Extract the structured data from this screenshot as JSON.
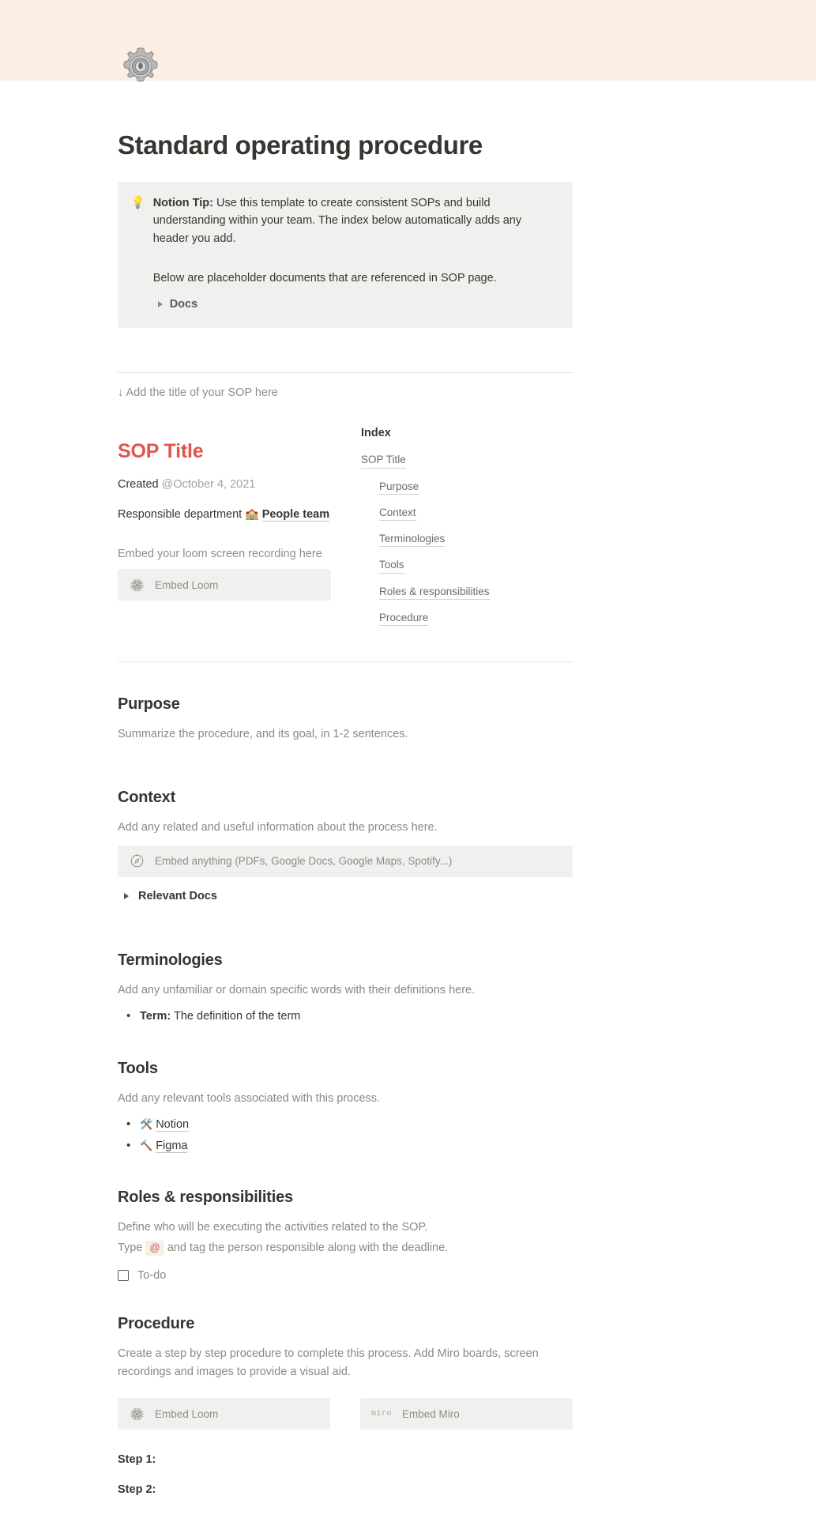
{
  "cover": {
    "color": "#fbeee4"
  },
  "page": {
    "icon": "gear-emoji",
    "title": "Standard operating procedure"
  },
  "callout": {
    "emoji": "light-bulb",
    "tip_label": "Notion Tip:",
    "tip_text": " Use this template to create consistent SOPs and build understanding within your team. The index below automatically adds any header you add.",
    "second_paragraph": "Below are placeholder documents that are referenced in SOP page.",
    "toggle_label": "Docs"
  },
  "hint": "↓ Add the title of your SOP here",
  "sop": {
    "title": "SOP Title",
    "created_label": "Created",
    "created_value": "@October 4, 2021",
    "department_label": "Responsible department",
    "department_emoji": "🏫",
    "department_value": "People team",
    "embed_caption": "Embed your loom screen recording here",
    "embed_loom_label": "Embed Loom"
  },
  "index": {
    "heading": "Index",
    "items": [
      {
        "label": "SOP Title",
        "level": 1
      },
      {
        "label": "Purpose",
        "level": 2
      },
      {
        "label": "Context",
        "level": 2
      },
      {
        "label": "Terminologies",
        "level": 2
      },
      {
        "label": "Tools",
        "level": 2
      },
      {
        "label": "Roles & responsibilities",
        "level": 2
      },
      {
        "label": "Procedure",
        "level": 2
      }
    ]
  },
  "sections": {
    "purpose": {
      "heading": "Purpose",
      "text": "Summarize the procedure, and its goal, in 1-2 sentences."
    },
    "context": {
      "heading": "Context",
      "text": "Add any related and useful information about the process here.",
      "embed_label": "Embed anything (PDFs, Google Docs, Google Maps, Spotify...)",
      "toggle_label": "Relevant Docs"
    },
    "terminologies": {
      "heading": "Terminologies",
      "text": "Add any unfamiliar or domain specific words with their definitions here.",
      "bullet_term": "Term:",
      "bullet_definition": " The definition of the term"
    },
    "tools": {
      "heading": "Tools",
      "text": "Add any relevant tools associated with this process.",
      "items": [
        {
          "emoji": "🛠️",
          "label": "Notion"
        },
        {
          "emoji": "🔨",
          "label": "Figma"
        }
      ]
    },
    "roles": {
      "heading": "Roles & responsibilities",
      "text": "Define who will be executing the activities related to the SOP.",
      "text2_before": "Type ",
      "mention_chip": "@",
      "text2_after": " and tag the person responsible along with the deadline.",
      "todo_label": "To-do"
    },
    "procedure": {
      "heading": "Procedure",
      "text": "Create a step by step procedure to complete this process. Add Miro boards, screen recordings and images to provide a visual aid.",
      "embed_loom_label": "Embed Loom",
      "embed_miro_mark": "miro",
      "embed_miro_label": "Embed Miro",
      "step1": "Step 1:",
      "step2": "Step 2:"
    }
  }
}
